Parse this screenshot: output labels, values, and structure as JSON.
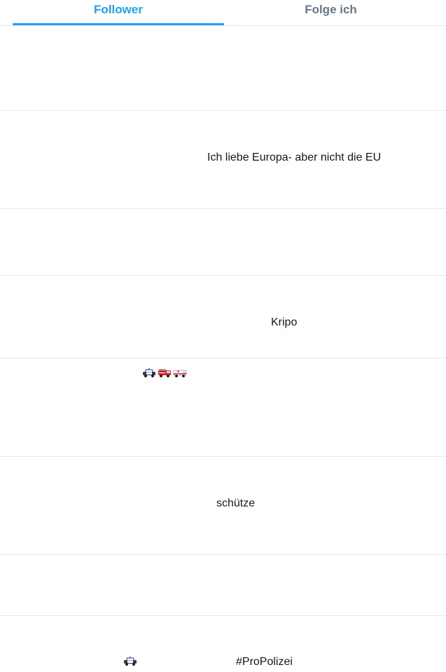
{
  "tabs": {
    "follower_label": "Follower",
    "following_label": "Folge ich",
    "active": "Follower",
    "accent_color": "#1da1f2",
    "inactive_color": "#657786"
  },
  "rows": [
    {
      "bio": ""
    },
    {
      "bio": "Ich liebe Europa- aber nicht die EU"
    },
    {
      "bio": ""
    },
    {
      "bio": "Kripo"
    },
    {
      "bio": "",
      "emoji_icons": [
        "police-car-icon",
        "fire-engine-icon",
        "ambulance-icon"
      ]
    },
    {
      "bio": "schütze"
    },
    {
      "bio": ""
    },
    {
      "bio": "#ProPolizei",
      "emoji_icons": [
        "police-car-icon"
      ]
    }
  ]
}
